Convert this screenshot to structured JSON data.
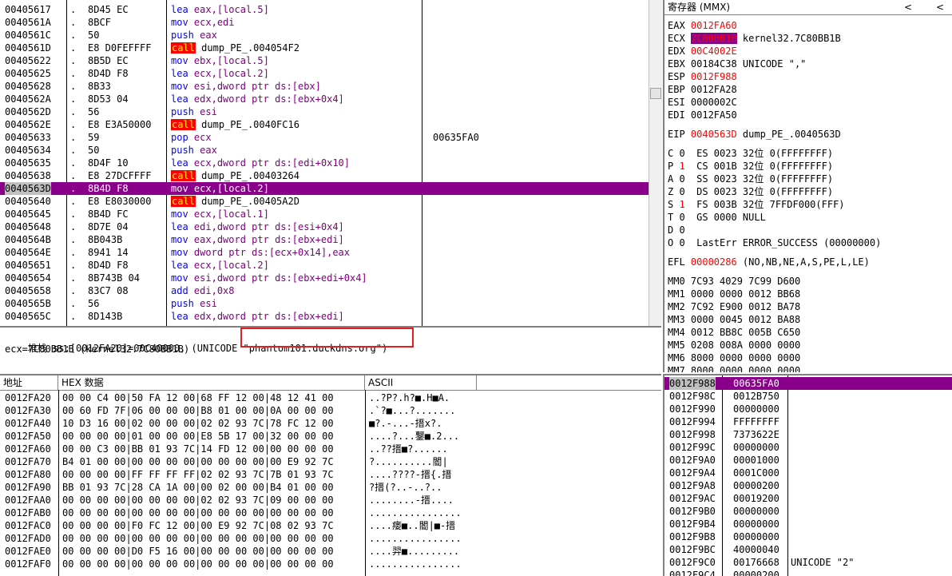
{
  "disasm": {
    "rows": [
      {
        "addr": "00405617",
        "mark": ".",
        "hex": "8D45 EC",
        "mn": "lea",
        "ops": "eax,[local.5]",
        "comment": ""
      },
      {
        "addr": "0040561A",
        "mark": ".",
        "hex": "8BCF",
        "mn": "mov",
        "ops": "ecx,edi",
        "comment": ""
      },
      {
        "addr": "0040561C",
        "mark": ".",
        "hex": "50",
        "mn": "push",
        "ops": "eax",
        "comment": ""
      },
      {
        "addr": "0040561D",
        "mark": ".",
        "hex": "E8 D0FEFFFF",
        "mn": "call",
        "ops": "dump_PE_.004054F2",
        "comment": ""
      },
      {
        "addr": "00405622",
        "mark": ".",
        "hex": "8B5D EC",
        "mn": "mov",
        "ops": "ebx,[local.5]",
        "comment": ""
      },
      {
        "addr": "00405625",
        "mark": ".",
        "hex": "8D4D F8",
        "mn": "lea",
        "ops": "ecx,[local.2]",
        "comment": ""
      },
      {
        "addr": "00405628",
        "mark": ".",
        "hex": "8B33",
        "mn": "mov",
        "ops": "esi,dword ptr ds:[ebx]",
        "comment": ""
      },
      {
        "addr": "0040562A",
        "mark": ".",
        "hex": "8D53 04",
        "mn": "lea",
        "ops": "edx,dword ptr ds:[ebx+0x4]",
        "comment": ""
      },
      {
        "addr": "0040562D",
        "mark": ".",
        "hex": "56",
        "mn": "push",
        "ops": "esi",
        "comment": ""
      },
      {
        "addr": "0040562E",
        "mark": ".",
        "hex": "E8 E3A50000",
        "mn": "call",
        "ops": "dump_PE_.0040FC16",
        "comment": ""
      },
      {
        "addr": "00405633",
        "mark": ".",
        "hex": "59",
        "mn": "pop",
        "ops": "ecx",
        "comment": "00635FA0"
      },
      {
        "addr": "00405634",
        "mark": ".",
        "hex": "50",
        "mn": "push",
        "ops": "eax",
        "comment": ""
      },
      {
        "addr": "00405635",
        "mark": ".",
        "hex": "8D4F 10",
        "mn": "lea",
        "ops": "ecx,dword ptr ds:[edi+0x10]",
        "comment": ""
      },
      {
        "addr": "00405638",
        "mark": ".",
        "hex": "E8 27DCFFFF",
        "mn": "call",
        "ops": "dump_PE_.00403264",
        "comment": ""
      },
      {
        "addr": "0040563D",
        "mark": ".",
        "hex": "8B4D F8",
        "mn": "mov",
        "ops": "ecx,[local.2]",
        "comment": "",
        "selected": true
      },
      {
        "addr": "00405640",
        "mark": ".",
        "hex": "E8 E8030000",
        "mn": "call",
        "ops": "dump_PE_.00405A2D",
        "comment": ""
      },
      {
        "addr": "00405645",
        "mark": ".",
        "hex": "8B4D FC",
        "mn": "mov",
        "ops": "ecx,[local.1]",
        "comment": ""
      },
      {
        "addr": "00405648",
        "mark": ".",
        "hex": "8D7E 04",
        "mn": "lea",
        "ops": "edi,dword ptr ds:[esi+0x4]",
        "comment": ""
      },
      {
        "addr": "0040564B",
        "mark": ".",
        "hex": "8B043B",
        "mn": "mov",
        "ops": "eax,dword ptr ds:[ebx+edi]",
        "comment": ""
      },
      {
        "addr": "0040564E",
        "mark": ".",
        "hex": "8941 14",
        "mn": "mov",
        "ops": "dword ptr ds:[ecx+0x14],eax",
        "comment": ""
      },
      {
        "addr": "00405651",
        "mark": ".",
        "hex": "8D4D F8",
        "mn": "lea",
        "ops": "ecx,[local.2]",
        "comment": ""
      },
      {
        "addr": "00405654",
        "mark": ".",
        "hex": "8B743B 04",
        "mn": "mov",
        "ops": "esi,dword ptr ds:[ebx+edi+0x4]",
        "comment": ""
      },
      {
        "addr": "00405658",
        "mark": ".",
        "hex": "83C7 08",
        "mn": "add",
        "ops": "edi,0x8",
        "comment": ""
      },
      {
        "addr": "0040565B",
        "mark": ".",
        "hex": "56",
        "mn": "push",
        "ops": "esi",
        "comment": ""
      },
      {
        "addr": "0040565C",
        "mark": ".",
        "hex": "8D143B",
        "mn": "lea",
        "ops": "edx,dword ptr ds:[ebx+edi]",
        "comment": ""
      }
    ]
  },
  "info": {
    "line1_prefix": "堆栈 ss:[0012FA20]=00C40000, (UNICODE ",
    "line1_highlight": "\"phantom101.duckdns.org\")",
    "line2": "ecx=7C80BB1B (kernel32.7C80BB1B)"
  },
  "registers": {
    "title": "寄存器 (MMX)",
    "nav_left": "<",
    "nav_right": "<",
    "gp": [
      {
        "name": "EAX",
        "value": "0012FA60",
        "changed": true,
        "desc": ""
      },
      {
        "name": "ECX",
        "value": "7C80BB1B",
        "changed": true,
        "highlight": true,
        "desc": "kernel32.7C80BB1B"
      },
      {
        "name": "EDX",
        "value": "00C4002E",
        "changed": true,
        "desc": ""
      },
      {
        "name": "EBX",
        "value": "00184C38",
        "changed": false,
        "desc": "UNICODE \",\""
      },
      {
        "name": "ESP",
        "value": "0012F988",
        "changed": true,
        "desc": ""
      },
      {
        "name": "EBP",
        "value": "0012FA28",
        "changed": false,
        "desc": ""
      },
      {
        "name": "ESI",
        "value": "0000002C",
        "changed": false,
        "desc": ""
      },
      {
        "name": "EDI",
        "value": "0012FA50",
        "changed": false,
        "desc": ""
      }
    ],
    "eip": {
      "name": "EIP",
      "value": "0040563D",
      "desc": "dump_PE_.0040563D"
    },
    "flags": [
      {
        "f": "C",
        "v": "0",
        "changed": false,
        "seg": "ES 0023 32位 0(FFFFFFFF)"
      },
      {
        "f": "P",
        "v": "1",
        "changed": true,
        "seg": "CS 001B 32位 0(FFFFFFFF)"
      },
      {
        "f": "A",
        "v": "0",
        "changed": false,
        "seg": "SS 0023 32位 0(FFFFFFFF)"
      },
      {
        "f": "Z",
        "v": "0",
        "changed": false,
        "seg": "DS 0023 32位 0(FFFFFFFF)"
      },
      {
        "f": "S",
        "v": "1",
        "changed": true,
        "seg": "FS 003B 32位 7FFDF000(FFF)"
      },
      {
        "f": "T",
        "v": "0",
        "changed": false,
        "seg": "GS 0000 NULL"
      },
      {
        "f": "D",
        "v": "0",
        "changed": false,
        "seg": ""
      },
      {
        "f": "O",
        "v": "0",
        "changed": false,
        "seg": "LastErr ERROR_SUCCESS (00000000)"
      }
    ],
    "efl": {
      "name": "EFL",
      "value": "00000286",
      "desc": "(NO,NB,NE,A,S,PE,L,LE)"
    },
    "mmx": [
      "MM0 7C93 4029 7C99 D600",
      "MM1 0000 0000 0012 BB68",
      "MM2 7C92 E900 0012 BA78",
      "MM3 0000 0045 0012 BA88",
      "MM4 0012 BB8C 005B C650",
      "MM5 0208 008A 0000 0000",
      "MM6 8000 0000 0000 0000",
      "MM7 8000 0000 0000 0000"
    ]
  },
  "dump": {
    "headers": {
      "addr": "地址",
      "hex": "HEX 数据",
      "ascii": "ASCII"
    },
    "rows": [
      {
        "addr": "0012FA20",
        "hex": "00 00 C4 00|50 FA 12 00|68 FF 12 00|48 12 41 00",
        "ascii": "..?P?.h?■.H■A."
      },
      {
        "addr": "0012FA30",
        "hex": "00 60 FD 7F|06 00 00 00|B8 01 00 00|0A 00 00 00",
        "ascii": ".`?■...?......."
      },
      {
        "addr": "0012FA40",
        "hex": "10 D3 16 00|02 00 00 00|02 02 93 7C|78 FC 12 00",
        "ascii": "■?.-...-搢x?."
      },
      {
        "addr": "0012FA50",
        "hex": "00 00 00 00|01 00 00 00|E8 5B 17 00|32 00 00 00",
        "ascii": "....?...鑋■.2..."
      },
      {
        "addr": "0012FA60",
        "hex": "00 00 C3 00|BB 01 93 7C|14 FD 12 00|00 00 00 00",
        "ascii": "..??搢■?......"
      },
      {
        "addr": "0012FA70",
        "hex": "B4 01 00 00|00 00 00 00|00 00 00 00|00 E9 92 7C",
        "ascii": "?..........閽|"
      },
      {
        "addr": "0012FA80",
        "hex": "00 00 00 00|FF FF FF FF|02 02 93 7C|7B 01 93 7C",
        "ascii": "....????-搢{.搢"
      },
      {
        "addr": "0012FA90",
        "hex": "BB 01 93 7C|28 CA 1A 00|00 02 00 00|B4 01 00 00",
        "ascii": "?搢(?..-..?.."
      },
      {
        "addr": "0012FAA0",
        "hex": "00 00 00 00|00 00 00 00|02 02 93 7C|09 00 00 00",
        "ascii": "........-搢...."
      },
      {
        "addr": "0012FAB0",
        "hex": "00 00 00 00|00 00 00 00|00 00 00 00|00 00 00 00",
        "ascii": "................"
      },
      {
        "addr": "0012FAC0",
        "hex": "00 00 00 00|F0 FC 12 00|00 E9 92 7C|08 02 93 7C",
        "ascii": "....瘘■..閽|■-搢"
      },
      {
        "addr": "0012FAD0",
        "hex": "00 00 00 00|00 00 00 00|00 00 00 00|00 00 00 00",
        "ascii": "................"
      },
      {
        "addr": "0012FAE0",
        "hex": "00 00 00 00|D0 F5 16 00|00 00 00 00|00 00 00 00",
        "ascii": "....羿■........."
      },
      {
        "addr": "0012FAF0",
        "hex": "00 00 00 00|00 00 00 00|00 00 00 00|00 00 00 00",
        "ascii": "................"
      }
    ]
  },
  "stack": {
    "rows": [
      {
        "addr": "0012F988",
        "value": "00635FA0",
        "comment": "",
        "selected": true
      },
      {
        "addr": "0012F98C",
        "value": "0012B750",
        "comment": ""
      },
      {
        "addr": "0012F990",
        "value": "00000000",
        "comment": ""
      },
      {
        "addr": "0012F994",
        "value": "FFFFFFFF",
        "comment": ""
      },
      {
        "addr": "0012F998",
        "value": "7373622E",
        "comment": ""
      },
      {
        "addr": "0012F99C",
        "value": "00000000",
        "comment": ""
      },
      {
        "addr": "0012F9A0",
        "value": "00001000",
        "comment": ""
      },
      {
        "addr": "0012F9A4",
        "value": "0001C000",
        "comment": ""
      },
      {
        "addr": "0012F9A8",
        "value": "00000200",
        "comment": ""
      },
      {
        "addr": "0012F9AC",
        "value": "00019200",
        "comment": ""
      },
      {
        "addr": "0012F9B0",
        "value": "00000000",
        "comment": ""
      },
      {
        "addr": "0012F9B4",
        "value": "00000000",
        "comment": ""
      },
      {
        "addr": "0012F9B8",
        "value": "00000000",
        "comment": ""
      },
      {
        "addr": "0012F9BC",
        "value": "40000040",
        "comment": ""
      },
      {
        "addr": "0012F9C0",
        "value": "00176668",
        "comment": "UNICODE \"2\""
      },
      {
        "addr": "0012F9C4",
        "value": "00000200",
        "comment": ""
      }
    ]
  }
}
